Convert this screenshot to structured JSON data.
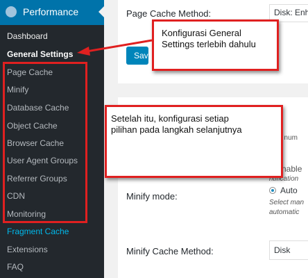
{
  "sidebar": {
    "brand_label": "Performance",
    "brand_icon": "performance-gauge-icon",
    "items": [
      {
        "label": "Dashboard"
      },
      {
        "label": "General Settings"
      },
      {
        "label": "Page Cache"
      },
      {
        "label": "Minify"
      },
      {
        "label": "Database Cache"
      },
      {
        "label": "Object Cache"
      },
      {
        "label": "Browser Cache"
      },
      {
        "label": "User Agent Groups"
      },
      {
        "label": "Referrer Groups"
      },
      {
        "label": "CDN"
      },
      {
        "label": "Monitoring"
      },
      {
        "label": "Fragment Cache"
      },
      {
        "label": "Extensions"
      },
      {
        "label": "FAQ"
      }
    ]
  },
  "main": {
    "page_cache_method_label": "Page Cache Method:",
    "page_cache_method_value": "Disk: Enh",
    "save_button_label": "Save",
    "side_text_1": "ld num",
    "enable_label": "Enable",
    "notification_text": "ntification",
    "minify_mode_label": "Minify mode:",
    "minify_mode_value": "Auto",
    "minify_help_1": "Select man",
    "minify_help_2": "automatic",
    "minify_cache_method_label": "Minify Cache Method:",
    "minify_cache_method_value": "Disk"
  },
  "annotations": {
    "callout_1": [
      "Konfigurasi General",
      "Settings terlebih dahulu"
    ],
    "callout_2": [
      "Setelah itu, konfigurasi setiap",
      "pilihan pada langkah selanjutnya"
    ],
    "highlight_color": "#e02020"
  }
}
